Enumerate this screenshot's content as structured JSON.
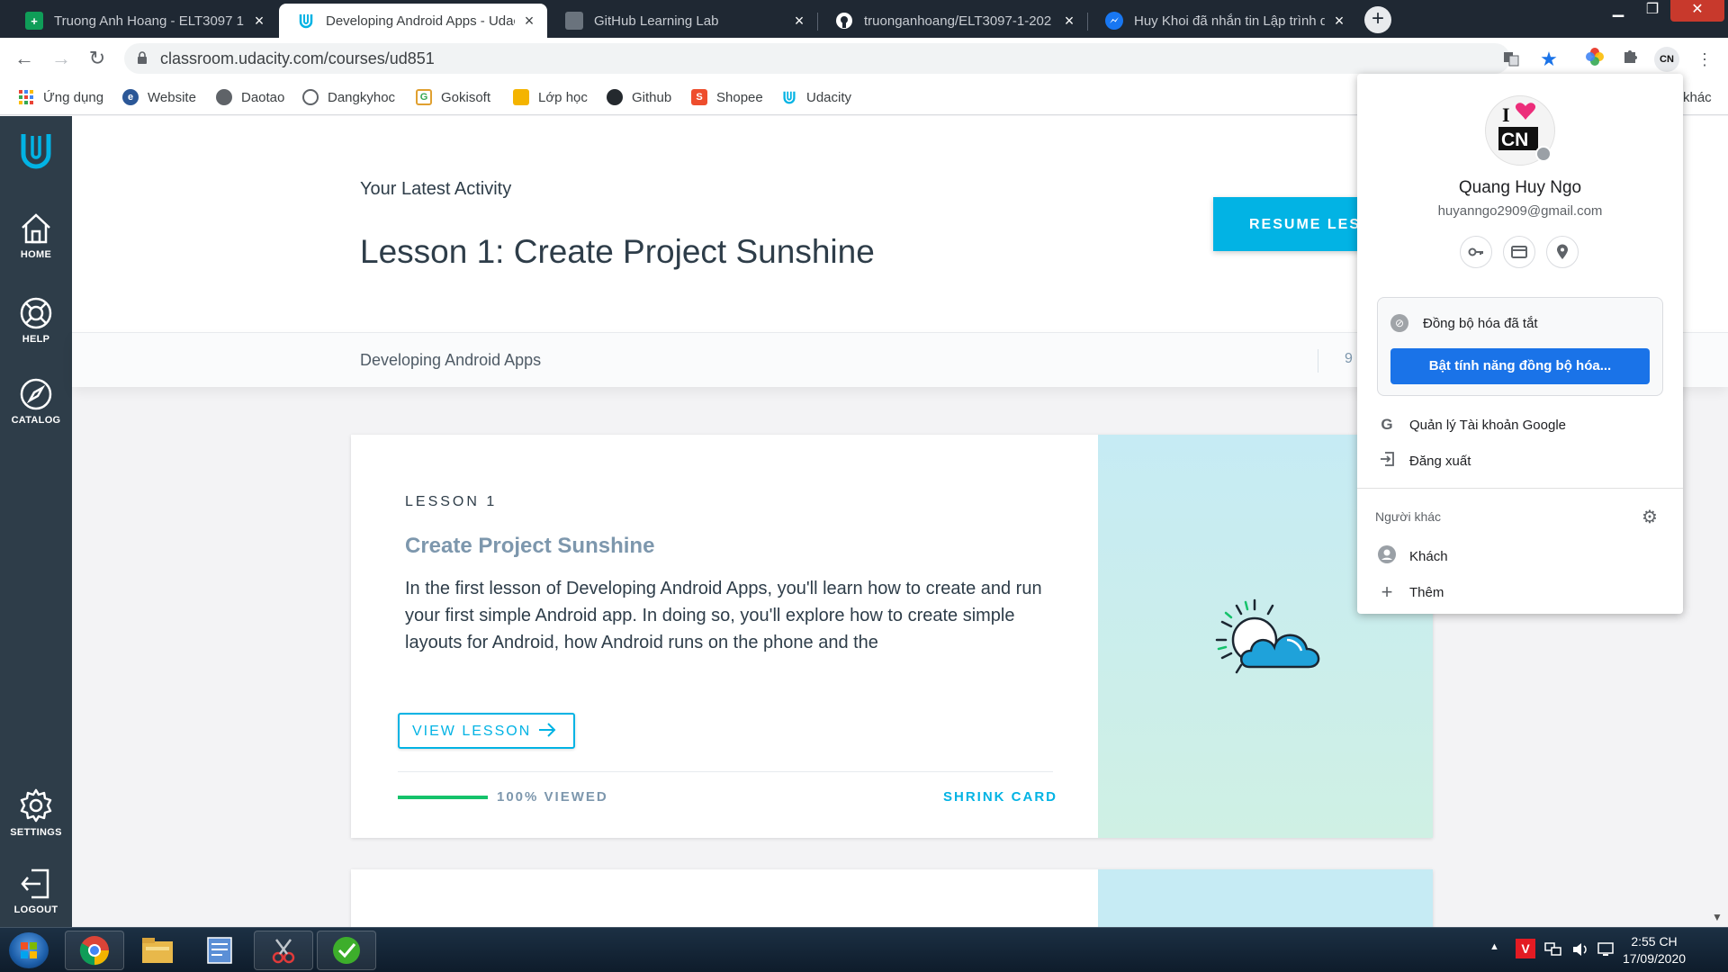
{
  "browser": {
    "tabs": [
      {
        "title": "Truong Anh Hoang - ELT3097 1 -",
        "favicon": "sheets-icon",
        "active": false
      },
      {
        "title": "Developing Android Apps - Udac",
        "favicon": "udacity-icon",
        "active": true
      },
      {
        "title": "GitHub Learning Lab",
        "favicon": "learning-lab-icon",
        "active": false
      },
      {
        "title": "truonganhoang/ELT3097-1-202",
        "favicon": "github-icon",
        "active": false
      },
      {
        "title": "Huy Khoi đã nhắn tin Lập trình d",
        "favicon": "messenger-icon",
        "active": false
      }
    ],
    "url": "classroom.udacity.com/courses/ud851",
    "bookmarks": [
      {
        "label": "Ứng dụng",
        "icon": "apps-grid-icon"
      },
      {
        "label": "Website",
        "icon": "globe-icon"
      },
      {
        "label": "Daotao",
        "icon": "globe-icon"
      },
      {
        "label": "Dangkyhoc",
        "icon": "globe-icon"
      },
      {
        "label": "Gokisoft",
        "icon": "gokisoft-icon"
      },
      {
        "label": "Lớp học",
        "icon": "classroom-icon"
      },
      {
        "label": "Github",
        "icon": "github-icon"
      },
      {
        "label": "Shopee",
        "icon": "shopee-icon"
      },
      {
        "label": "Udacity",
        "icon": "udacity-icon"
      }
    ],
    "other_bookmarks_partial": "khác"
  },
  "sidebar": {
    "items": [
      {
        "label": "HOME",
        "icon": "home-icon"
      },
      {
        "label": "HELP",
        "icon": "help-lifebuoy-icon"
      },
      {
        "label": "CATALOG",
        "icon": "compass-icon"
      },
      {
        "label": "SETTINGS",
        "icon": "gear-icon"
      },
      {
        "label": "LOGOUT",
        "icon": "logout-icon"
      }
    ]
  },
  "activity": {
    "kicker": "Your Latest Activity",
    "title": "Lesson 1: Create Project Sunshine",
    "resume_label": "RESUME LESS",
    "course_name": "Developing Android Apps",
    "course_progress_partial": "9"
  },
  "lesson_card": {
    "kicker": "LESSON 1",
    "title": "Create Project Sunshine",
    "description": "In the first lesson of Developing Android Apps, you'll learn how to create and run your first simple Android app. In doing so, you'll explore how to create simple layouts for Android, how Android runs on the phone and the",
    "view_label": "VIEW LESSON",
    "progress_label": "100% VIEWED",
    "progress_fraction": 1.0,
    "shrink_label": "SHRINK CARD",
    "art_icon": "sun-cloud-icon"
  },
  "profile_popup": {
    "name": "Quang Huy Ngo",
    "email": "huyanngo2909@gmail.com",
    "quick_buttons": [
      {
        "icon": "key-icon"
      },
      {
        "icon": "credit-card-icon"
      },
      {
        "icon": "location-pin-icon"
      }
    ],
    "sync_status": "Đồng bộ hóa đã tắt",
    "sync_button": "Bật tính năng đồng bộ hóa...",
    "manage_account": "Quản lý Tài khoản Google",
    "sign_out": "Đăng xuất",
    "other_people": "Người khác",
    "guest": "Khách",
    "add": "Thêm"
  },
  "taskbar": {
    "apps": [
      {
        "icon": "chrome-icon"
      },
      {
        "icon": "file-explorer-icon"
      },
      {
        "icon": "notepad-icon"
      },
      {
        "icon": "snipping-tool-icon"
      },
      {
        "icon": "green-app-icon"
      }
    ],
    "time": "2:55 CH",
    "date": "17/09/2020"
  },
  "colors": {
    "udacity_blue": "#02b3e4",
    "sidebar_bg": "#2e3d49",
    "progress_green": "#15c26b",
    "chrome_blue": "#1a73e8",
    "tabstrip_bg": "#1f2833"
  }
}
